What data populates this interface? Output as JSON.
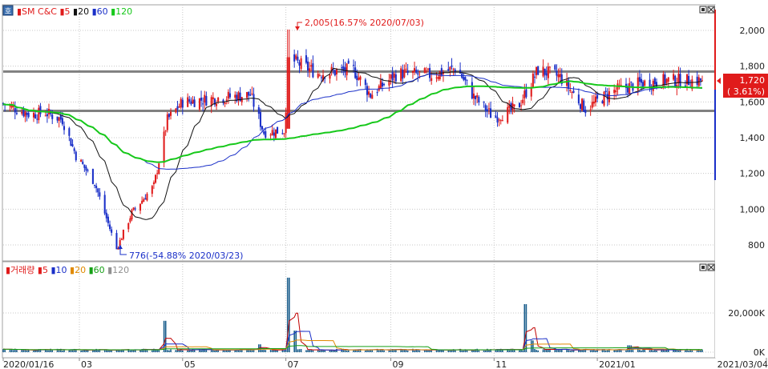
{
  "window": {
    "title_icon": "zoom-icon",
    "icon_glyph": "호",
    "panel_buttons": [
      "restore-icon",
      "close-icon"
    ]
  },
  "colors": {
    "up": "#e01b1b",
    "down": "#1a2fc8",
    "ma5": "#111111",
    "ma20": "#111111",
    "ma60": "#1a2fc8",
    "ma120": "#16c81a",
    "vol_ma5": "#c00000",
    "vol_ma10": "#1a2fc8",
    "vol_ma20": "#e08a00",
    "vol_ma60": "#16a016",
    "vol_ma120": "#909090",
    "ref_line": "#808080",
    "grid": "#c8c8c8"
  },
  "price_legend": {
    "name": "SM C&C",
    "items": [
      {
        "label": "5",
        "color": "#e01b1b"
      },
      {
        "label": "20",
        "color": "#111111"
      },
      {
        "label": "60",
        "color": "#1a2fc8"
      },
      {
        "label": "120",
        "color": "#16c81a"
      }
    ]
  },
  "volume_legend": {
    "name": "거래량",
    "items": [
      {
        "label": "5",
        "color": "#e01b1b"
      },
      {
        "label": "10",
        "color": "#1a2fc8"
      },
      {
        "label": "20",
        "color": "#e08a00"
      },
      {
        "label": "60",
        "color": "#16a016"
      },
      {
        "label": "120",
        "color": "#909090"
      }
    ]
  },
  "price_axis": {
    "ticks": [
      "2,000",
      "1,800",
      "1,600",
      "1,400",
      "1,200",
      "1,000",
      "800"
    ]
  },
  "volume_axis": {
    "ticks": [
      "20,000K",
      "0K"
    ]
  },
  "x_axis": {
    "labels": [
      "2020/01/16",
      "03",
      "05",
      "07",
      "09",
      "11",
      "2021/01",
      "2021/03/04"
    ]
  },
  "annotations": {
    "high": "2,005(16.57% 2020/07/03)",
    "low": "776(-54.88% 2020/03/23)"
  },
  "current": {
    "price": "1,720",
    "change": "( 3.61%)"
  },
  "chart_data": [
    {
      "type": "candlestick",
      "title": "SM C&C",
      "ylim": [
        700,
        2100
      ],
      "y_ticks": [
        800,
        1000,
        1200,
        1400,
        1600,
        1800,
        2000
      ],
      "x_ticks": [
        "2020/01/16",
        "2020/03",
        "2020/05",
        "2020/07",
        "2020/09",
        "2020/11",
        "2021/01",
        "2021/03/04"
      ],
      "reference_lines": [
        1770,
        1550
      ],
      "high": {
        "value": 2005,
        "pct": 16.57,
        "date": "2020/07/03"
      },
      "low": {
        "value": 776,
        "pct": -54.88,
        "date": "2020/03/23"
      },
      "last": {
        "value": 1720,
        "pct": 3.61
      },
      "close_path": [
        {
          "d": "2020/01/16",
          "v": 1590
        },
        {
          "d": "2020/02/01",
          "v": 1530
        },
        {
          "d": "2020/02/10",
          "v": 1540
        },
        {
          "d": "2020/02/20",
          "v": 1500
        },
        {
          "d": "2020/02/28",
          "v": 1300
        },
        {
          "d": "2020/03/10",
          "v": 1150
        },
        {
          "d": "2020/03/23",
          "v": 776
        },
        {
          "d": "2020/04/01",
          "v": 980
        },
        {
          "d": "2020/04/14",
          "v": 1130
        },
        {
          "d": "2020/04/22",
          "v": 1500
        },
        {
          "d": "2020/05/01",
          "v": 1600
        },
        {
          "d": "2020/05/20",
          "v": 1620
        },
        {
          "d": "2020/06/10",
          "v": 1640
        },
        {
          "d": "2020/06/18",
          "v": 1430
        },
        {
          "d": "2020/06/30",
          "v": 1440
        },
        {
          "d": "2020/07/03",
          "v": 1840
        },
        {
          "d": "2020/07/20",
          "v": 1760
        },
        {
          "d": "2020/08/10",
          "v": 1780
        },
        {
          "d": "2020/08/20",
          "v": 1640
        },
        {
          "d": "2020/09/05",
          "v": 1760
        },
        {
          "d": "2020/09/25",
          "v": 1750
        },
        {
          "d": "2020/10/10",
          "v": 1790
        },
        {
          "d": "2020/10/20",
          "v": 1630
        },
        {
          "d": "2020/11/01",
          "v": 1510
        },
        {
          "d": "2020/11/15",
          "v": 1570
        },
        {
          "d": "2020/11/27",
          "v": 1780
        },
        {
          "d": "2020/12/10",
          "v": 1740
        },
        {
          "d": "2020/12/25",
          "v": 1560
        },
        {
          "d": "2021/01/10",
          "v": 1660
        },
        {
          "d": "2021/01/25",
          "v": 1700
        },
        {
          "d": "2021/02/10",
          "v": 1720
        },
        {
          "d": "2021/03/04",
          "v": 1720
        }
      ],
      "moving_averages": [
        {
          "name": "5",
          "smoothing": 5
        },
        {
          "name": "20",
          "smoothing": 20
        },
        {
          "name": "60",
          "smoothing": 60
        },
        {
          "name": "120",
          "smoothing": 120
        }
      ]
    },
    {
      "type": "bar",
      "title": "거래량",
      "ylim": [
        0,
        40000
      ],
      "unit": "K",
      "y_ticks": [
        0,
        20000
      ],
      "spikes": [
        {
          "d": "2020/04/20",
          "v": 16000
        },
        {
          "d": "2020/07/03",
          "v": 38000
        },
        {
          "d": "2020/07/06",
          "v": 11000
        },
        {
          "d": "2020/11/20",
          "v": 24500
        },
        {
          "d": "2020/11/23",
          "v": 6000
        },
        {
          "d": "2020/06/15",
          "v": 4000
        },
        {
          "d": "2021/01/20",
          "v": 3500
        }
      ],
      "baseline": 800
    }
  ]
}
